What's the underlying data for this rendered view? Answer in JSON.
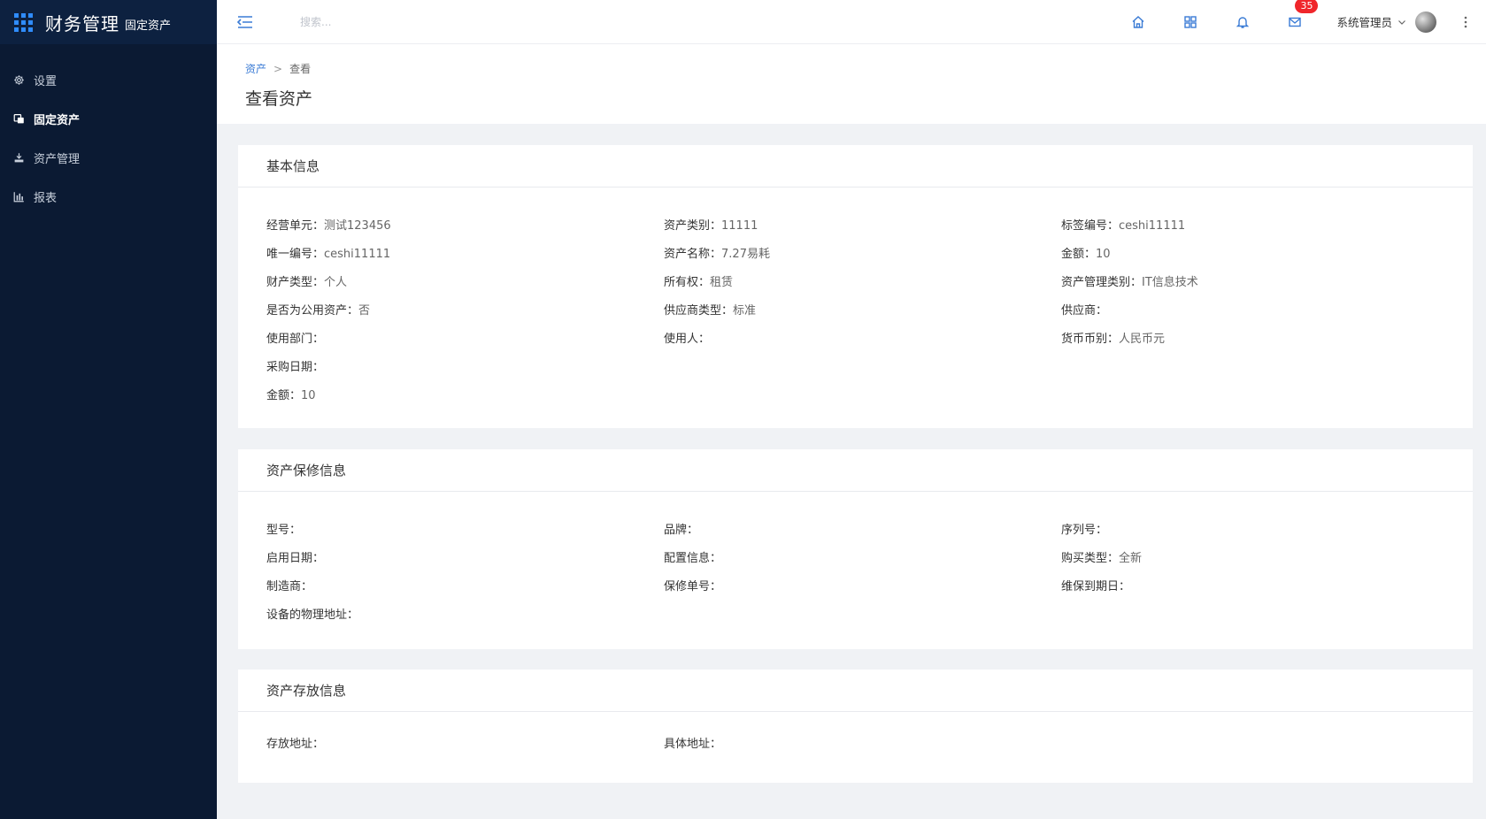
{
  "app": {
    "title": "财务管理",
    "subtitle": "固定资产"
  },
  "sidebar": {
    "items": [
      {
        "label": "设置",
        "icon": "gear-icon"
      },
      {
        "label": "固定资产",
        "icon": "asset-icon"
      },
      {
        "label": "资产管理",
        "icon": "manage-icon"
      },
      {
        "label": "报表",
        "icon": "chart-icon"
      }
    ]
  },
  "header": {
    "search_placeholder": "搜索...",
    "mail_badge": "35",
    "user_name": "系统管理员"
  },
  "breadcrumb": {
    "root": "资产",
    "separator": ">",
    "current": "查看"
  },
  "page_title": "查看资产",
  "basic": {
    "title": "基本信息",
    "fields": [
      {
        "label": "经营单元：",
        "value": "测试123456"
      },
      {
        "label": "资产类别：",
        "value": "11111"
      },
      {
        "label": "标签编号：",
        "value": "ceshi11111"
      },
      {
        "label": "唯一编号：",
        "value": "ceshi11111"
      },
      {
        "label": "资产名称：",
        "value": "7.27易耗"
      },
      {
        "label": "金额：",
        "value": "10"
      },
      {
        "label": "财产类型：",
        "value": "个人"
      },
      {
        "label": "所有权：",
        "value": "租赁"
      },
      {
        "label": "资产管理类别：",
        "value": "IT信息技术"
      },
      {
        "label": "是否为公用资产：",
        "value": "否"
      },
      {
        "label": "供应商类型：",
        "value": "标准"
      },
      {
        "label": "供应商：",
        "value": ""
      },
      {
        "label": "使用部门：",
        "value": ""
      },
      {
        "label": "使用人：",
        "value": ""
      },
      {
        "label": "货币币别：",
        "value": "人民币元"
      },
      {
        "label": "采购日期：",
        "value": ""
      },
      {
        "label": "金额：",
        "value": "10"
      }
    ]
  },
  "warranty": {
    "title": "资产保修信息",
    "fields": [
      {
        "label": "型号：",
        "value": ""
      },
      {
        "label": "品牌：",
        "value": ""
      },
      {
        "label": "序列号：",
        "value": ""
      },
      {
        "label": "启用日期：",
        "value": ""
      },
      {
        "label": "配置信息：",
        "value": ""
      },
      {
        "label": "购买类型：",
        "value": "全新"
      },
      {
        "label": "制造商：",
        "value": ""
      },
      {
        "label": "保修单号：",
        "value": ""
      },
      {
        "label": "维保到期日：",
        "value": ""
      },
      {
        "label": "设备的物理地址：",
        "value": ""
      }
    ]
  },
  "storage": {
    "title": "资产存放信息",
    "fields": [
      {
        "label": "存放地址：",
        "value": ""
      },
      {
        "label": "具体地址：",
        "value": ""
      }
    ]
  }
}
